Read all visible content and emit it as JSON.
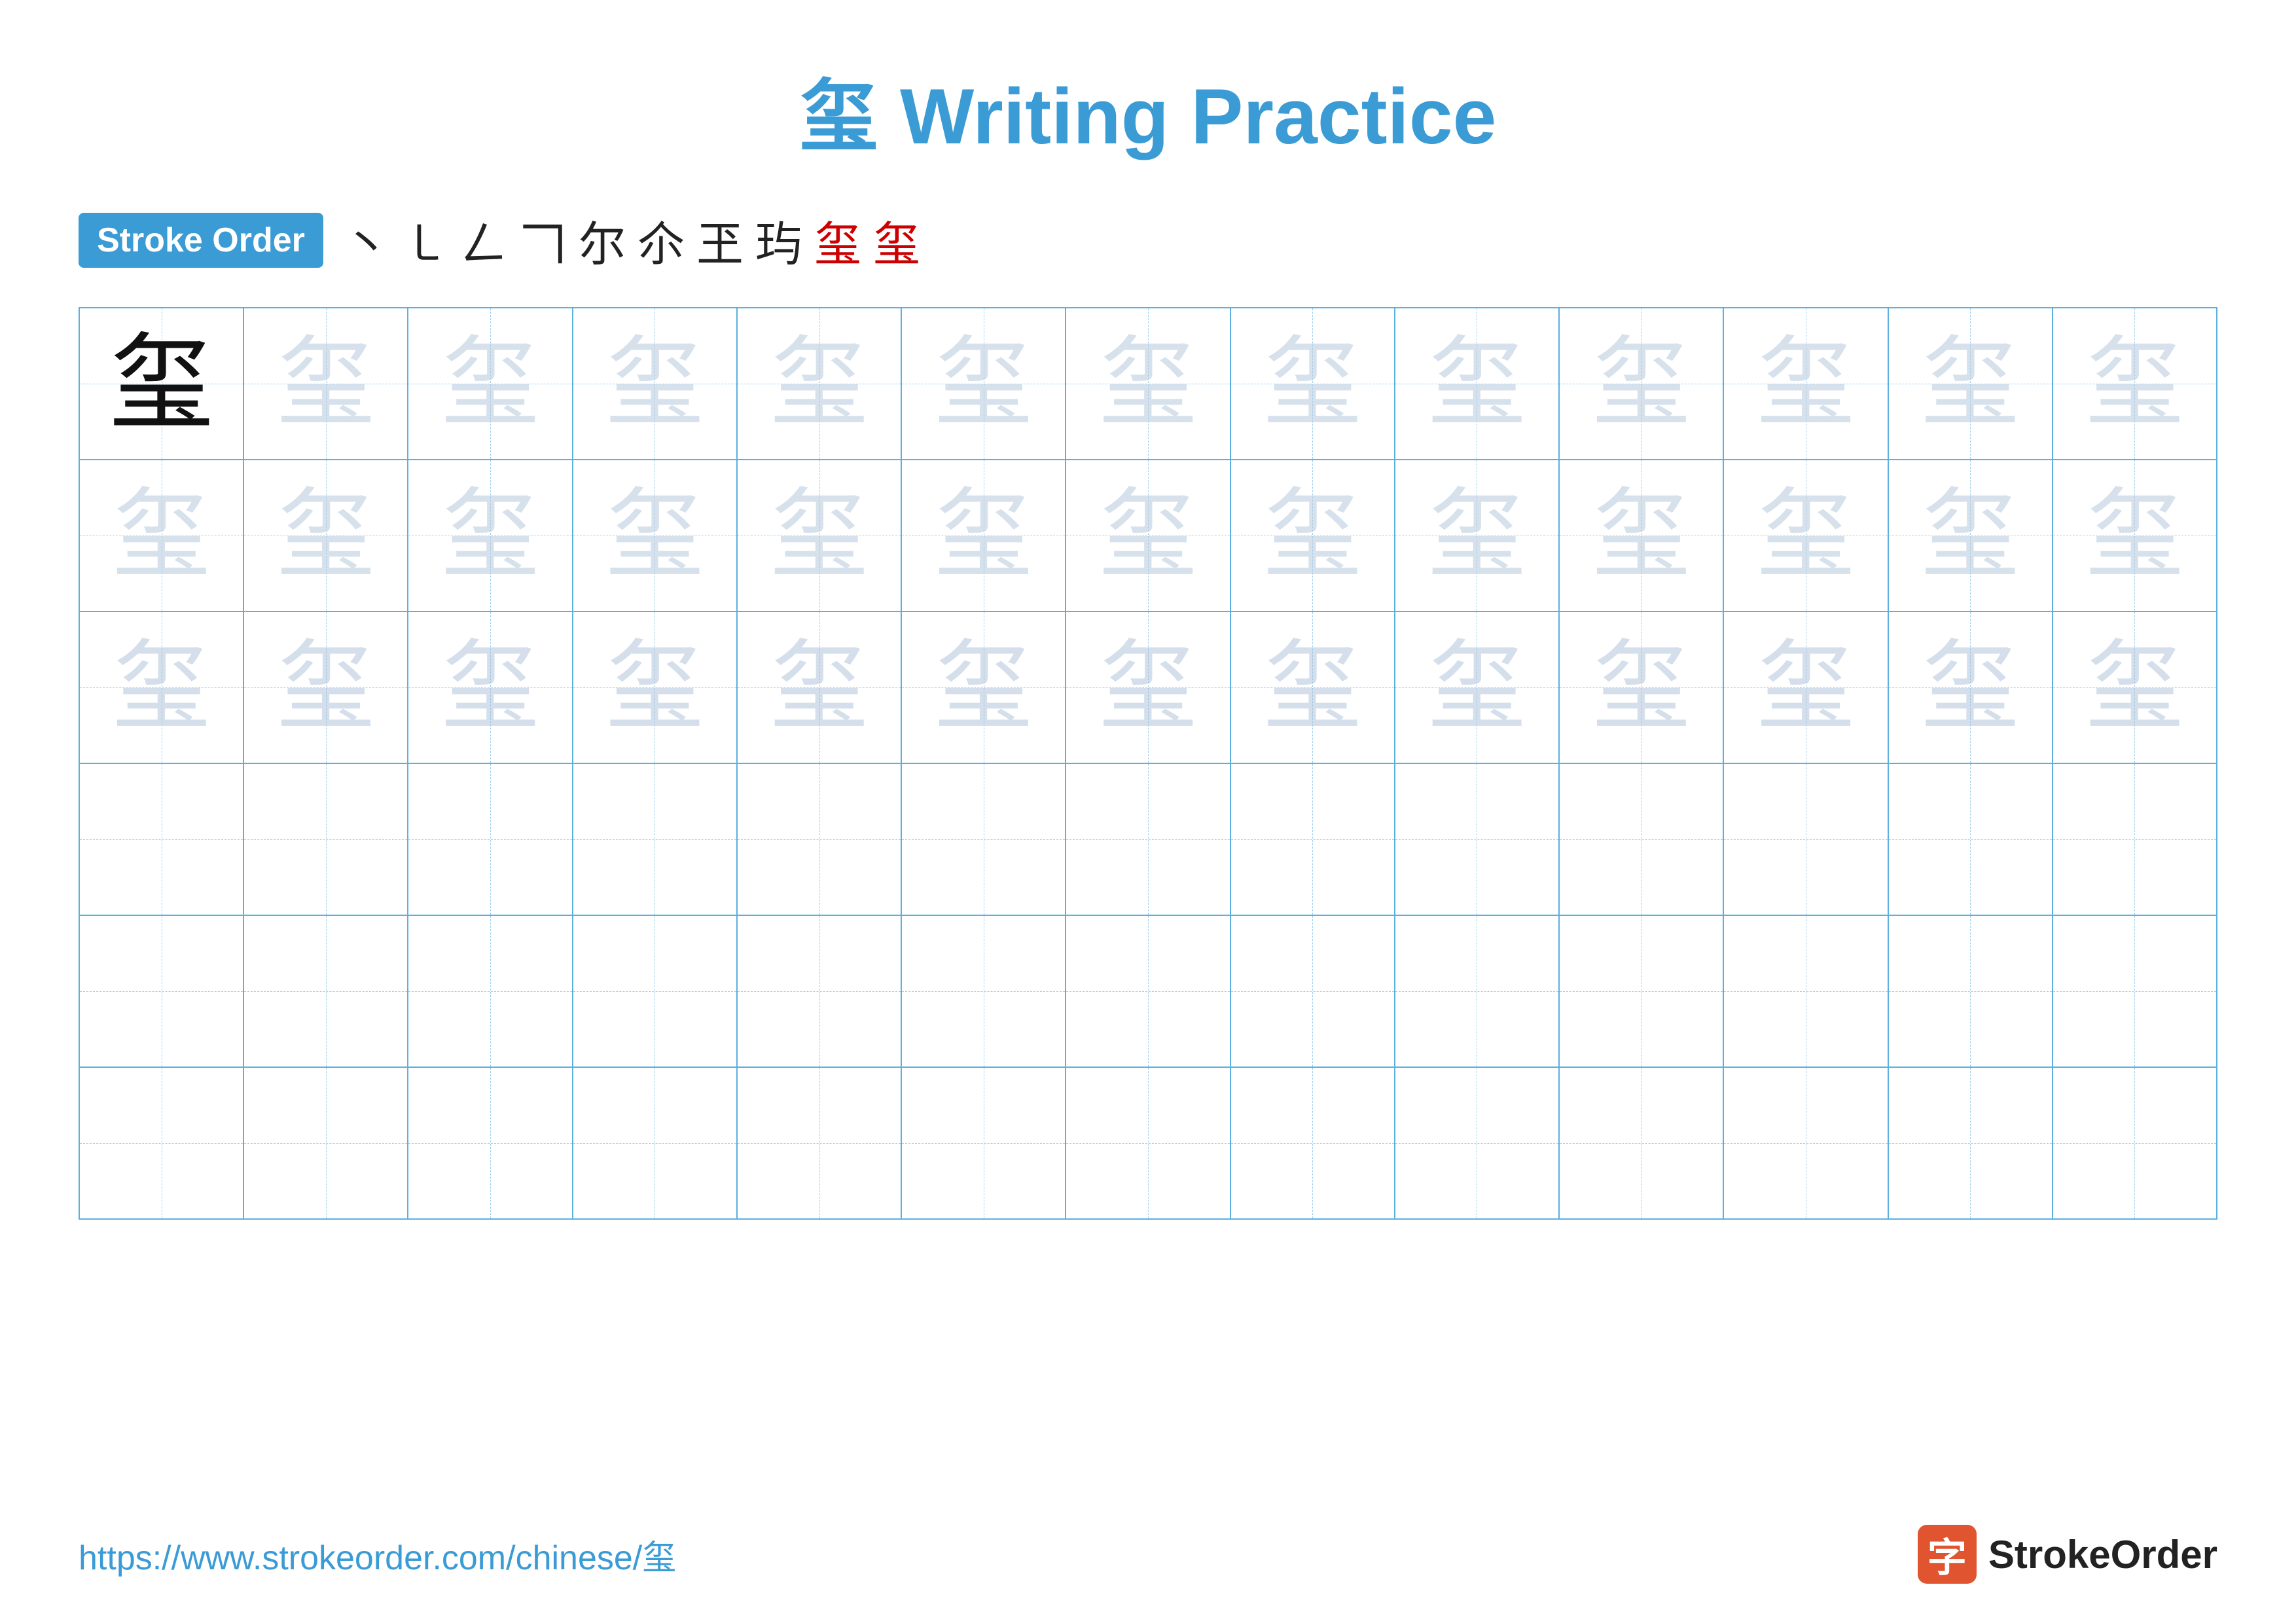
{
  "title": {
    "char": "玺",
    "label": "Writing Practice",
    "full": "玺 Writing Practice"
  },
  "stroke_order": {
    "badge_label": "Stroke Order",
    "steps": [
      "丶",
      "㇐",
      "𠃋",
      "𠃍",
      "尔",
      "尔",
      "尔",
      "玺",
      "玺",
      "玺"
    ]
  },
  "grid": {
    "rows": 6,
    "cols": 13,
    "char": "玺",
    "faded_rows": [
      1,
      2
    ],
    "empty_rows": [
      3,
      4,
      5
    ]
  },
  "footer": {
    "url": "https://www.strokeorder.com/chinese/玺",
    "logo_char": "字",
    "logo_text": "StrokeOrder"
  }
}
